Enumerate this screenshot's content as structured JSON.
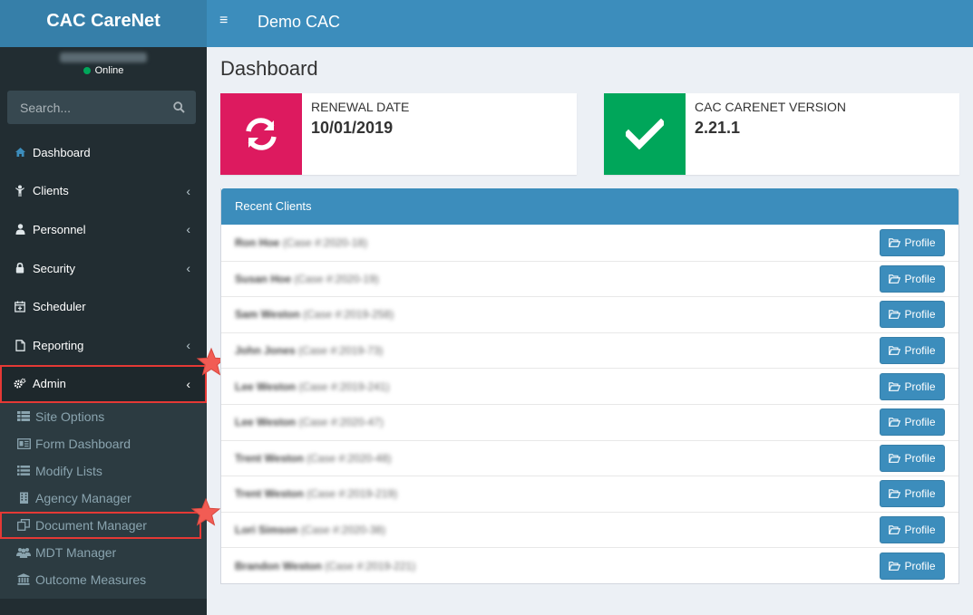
{
  "brand": "CAC CareNet",
  "user": {
    "name": "David McIntosh",
    "status": "Online"
  },
  "search": {
    "placeholder": "Search..."
  },
  "menu": [
    {
      "label": "Dashboard",
      "icon": "dashboard-icon"
    },
    {
      "label": "Clients",
      "icon": "child-icon"
    },
    {
      "label": "Personnel",
      "icon": "user-icon"
    },
    {
      "label": "Security",
      "icon": "lock-icon"
    },
    {
      "label": "Scheduler",
      "icon": "calendar-icon"
    },
    {
      "label": "Reporting",
      "icon": "file-icon"
    },
    {
      "label": "Admin",
      "icon": "cogs-icon"
    }
  ],
  "admin_submenu": [
    {
      "label": "Site Options",
      "icon": "th-list-icon"
    },
    {
      "label": "Form Dashboard",
      "icon": "form-icon"
    },
    {
      "label": "Modify Lists",
      "icon": "list-icon"
    },
    {
      "label": "Agency Manager",
      "icon": "building-icon"
    },
    {
      "label": "Document Manager",
      "icon": "files-icon"
    },
    {
      "label": "MDT Manager",
      "icon": "users-icon"
    },
    {
      "label": "Outcome Measures",
      "icon": "institution-icon"
    }
  ],
  "header": {
    "site_title": "Demo CAC"
  },
  "page_title": "Dashboard",
  "renewal": {
    "label": "RENEWAL DATE",
    "value": "10/01/2019",
    "color": "#dd1a5f"
  },
  "version": {
    "label": "CAC CARENET VERSION",
    "value": "2.21.1",
    "color": "#00a65a"
  },
  "recent_clients": {
    "title": "Recent Clients",
    "button_label": "Profile",
    "clients": [
      {
        "name": "Ron Hoe",
        "case": "(Case #:2020-18)"
      },
      {
        "name": "Susan Hoe",
        "case": "(Case #:2020-19)"
      },
      {
        "name": "Sam Weston",
        "case": "(Case #:2019-258)"
      },
      {
        "name": "John Jones",
        "case": "(Case #:2019-73)"
      },
      {
        "name": "Lee Weston",
        "case": "(Case #:2019-241)"
      },
      {
        "name": "Lee Weston",
        "case": "(Case #:2020-47)"
      },
      {
        "name": "Trent Weston",
        "case": "(Case #:2020-48)"
      },
      {
        "name": "Trent Weston",
        "case": "(Case #:2019-219)"
      },
      {
        "name": "Lori Simson",
        "case": "(Case #:2020-38)"
      },
      {
        "name": "Brandon Weston",
        "case": "(Case #:2019-221)"
      }
    ]
  },
  "colors": {
    "header": "#3c8dbc",
    "sidebar": "#222d32",
    "highlight": "#e53935"
  }
}
